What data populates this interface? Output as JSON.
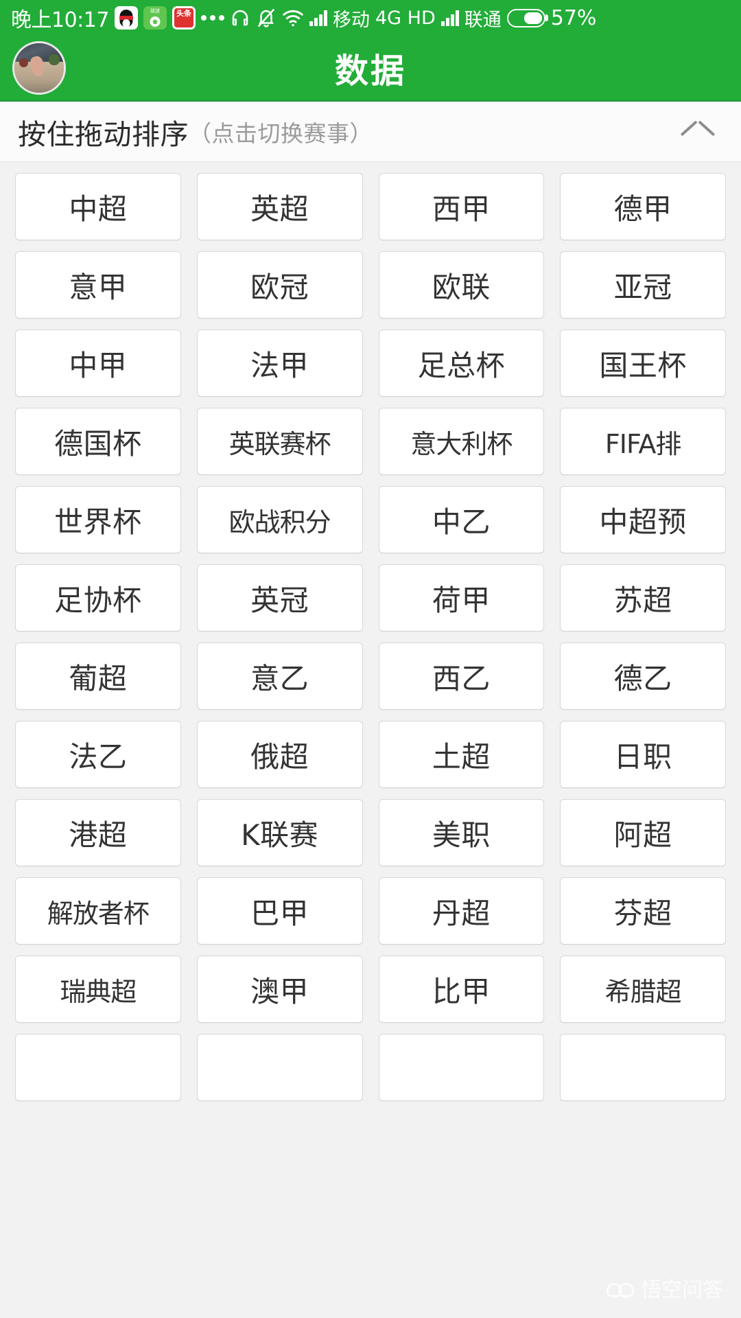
{
  "status_bar": {
    "time": "晚上10:17",
    "app_icons": [
      {
        "name": "qq-app-icon",
        "label": "QQ"
      },
      {
        "name": "football-app-icon",
        "label": "球"
      },
      {
        "name": "toutiao-app-icon",
        "label": "头条"
      }
    ],
    "more_icon": "more-dots-icon",
    "headset_icon": "headset-icon",
    "bell_muted_icon": "bell-muted-icon",
    "wifi_icon": "wifi-icon",
    "signal_icon_1": "signal-bars-icon",
    "carrier_1": "移动",
    "network_type": "4G HD",
    "signal_icon_2": "signal-bars-icon",
    "carrier_2": "联通",
    "battery_icon": "battery-icon",
    "battery_percent": "57%",
    "battery_level": 57
  },
  "header": {
    "title": "数据",
    "avatar": "user-avatar",
    "background_color": "#22AC38"
  },
  "sort_bar": {
    "main_text": "按住拖动排序",
    "hint_text": "（点击切换赛事）",
    "collapse_icon": "chevron-up-icon"
  },
  "leagues": [
    "中超",
    "英超",
    "西甲",
    "德甲",
    "意甲",
    "欧冠",
    "欧联",
    "亚冠",
    "中甲",
    "法甲",
    "足总杯",
    "国王杯",
    "德国杯",
    "英联赛杯",
    "意大利杯",
    "FIFA排",
    "世界杯",
    "欧战积分",
    "中乙",
    "中超预",
    "足协杯",
    "英冠",
    "荷甲",
    "苏超",
    "葡超",
    "意乙",
    "西乙",
    "德乙",
    "法乙",
    "俄超",
    "土超",
    "日职",
    "港超",
    "K联赛",
    "美职",
    "阿超",
    "解放者杯",
    "巴甲",
    "丹超",
    "芬超",
    "瑞典超",
    "澳甲",
    "比甲",
    "希腊超",
    "",
    "",
    "",
    ""
  ],
  "watermark": {
    "text": "悟空问答",
    "logo": "wukong-logo"
  },
  "colors": {
    "brand_green": "#22AC38",
    "page_background": "#f2f2f2",
    "cell_background": "#ffffff",
    "cell_border": "#d7d7d7",
    "text_primary": "#333333",
    "text_muted": "#9b9b9b"
  }
}
